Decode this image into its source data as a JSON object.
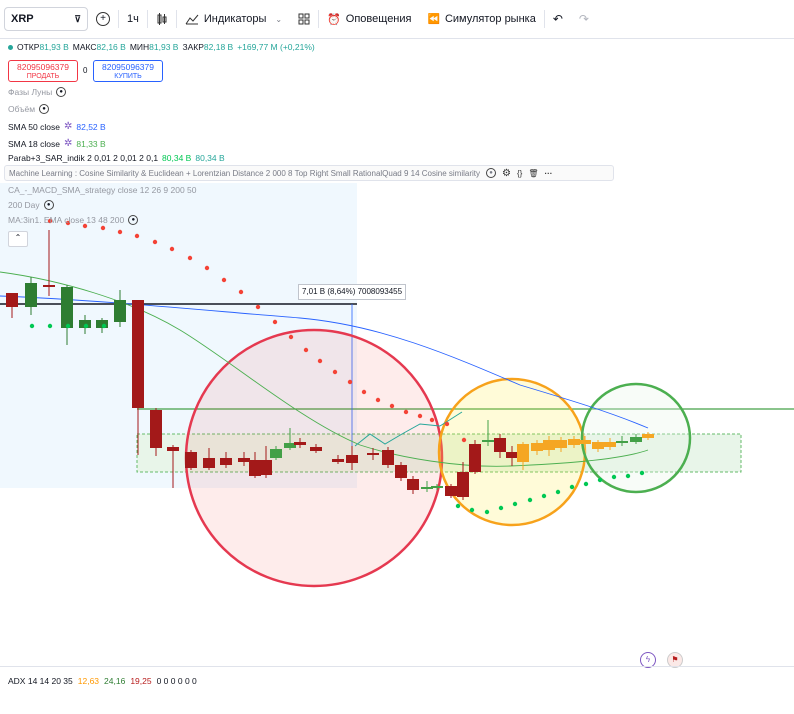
{
  "toolbar": {
    "symbol": "XRP",
    "interval": "1ч",
    "indicators_label": "Индикаторы",
    "alerts_label": "Оповещения",
    "replay_label": "Симулятор рынка"
  },
  "ohlc": {
    "open_label": "ОТКР",
    "open": "81,93 B",
    "high_label": "МАКС",
    "high": "82,16 B",
    "low_label": "МИН",
    "low": "81,93 B",
    "close_label": "ЗАКР",
    "close": "82,18 B",
    "change": "+169,77 M (+0,21%)"
  },
  "trade": {
    "sell_price": "82095096379",
    "sell_label": "ПРОДАТЬ",
    "spread": "0",
    "buy_price": "82095096379",
    "buy_label": "КУПИТЬ"
  },
  "indicators": {
    "moon": "Фазы Луны",
    "volume": "Объём",
    "sma50_label": "SMA 50 close",
    "sma50_value": "82,52 B",
    "sma18_label": "SMA 18 close",
    "sma18_value": "81,33 B",
    "parab_label": "Parab+3_SAR_indik 2 0,01 2 0,01 2 0,1",
    "parab_value1": "80,34 B",
    "parab_value2": "80,34 B",
    "ml_label": "Machine Learning : Cosine Similarity & Euclidean + Lorentzian Distance 2 000 8 Top Right Small RationalQuad 9 14 Cosine similarity",
    "macd_label": "CA_-_MACD_SMA_strategy close 12 26 9 200 50",
    "day200_label": "200 Day",
    "ma3in1_label": "MA:3in1. EMA close 13 48 200"
  },
  "measure_tooltip": "7,01 B (8,64%) 7008093455",
  "adx": {
    "label": "ADX 14 14 20 35",
    "v1": "12,63",
    "v2": "24,16",
    "v3": "19,25",
    "rest": "0 0 0 0 0 0"
  },
  "colors": {
    "up": "#26a69a",
    "down": "#b71c1c",
    "sma50": "#2962ff",
    "sma18": "#4caf50",
    "sar": "#f44336",
    "sar_low": "#00c853"
  }
}
